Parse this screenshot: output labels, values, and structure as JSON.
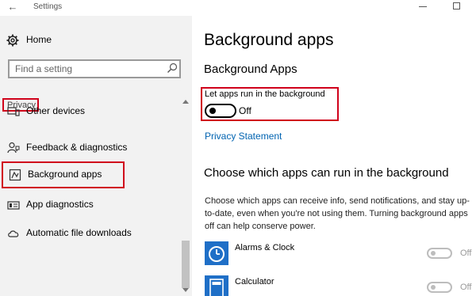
{
  "window": {
    "title": "Settings",
    "back_icon": "back-arrow-icon"
  },
  "sidebar": {
    "home_label": "Home",
    "search_placeholder": "Find a setting",
    "section_label": "Privacy",
    "items": [
      {
        "label": "Other devices",
        "icon": "devices-icon"
      },
      {
        "label": "Feedback & diagnostics",
        "icon": "feedback-icon"
      },
      {
        "label": "Background apps",
        "icon": "background-apps-icon",
        "selected": true
      },
      {
        "label": "App diagnostics",
        "icon": "app-diagnostics-icon"
      },
      {
        "label": "Automatic file downloads",
        "icon": "cloud-icon"
      }
    ]
  },
  "main": {
    "page_title": "Background apps",
    "section_title": "Background Apps",
    "toggle_label": "Let apps run in the background",
    "toggle_state": "Off",
    "privacy_link": "Privacy Statement",
    "choose_title": "Choose which apps can run in the background",
    "description": "Choose which apps can receive info, send notifications, and stay up-to-date, even when you're not using them. Turning background apps off can help conserve power.",
    "apps": [
      {
        "name": "Alarms & Clock",
        "state": "Off"
      },
      {
        "name": "Calculator",
        "state": "Off"
      }
    ]
  },
  "colors": {
    "highlight_border": "#d0021b",
    "link": "#0063b1",
    "app_tile": "#1f6fc7",
    "sidebar_bg": "#f2f2f2"
  }
}
